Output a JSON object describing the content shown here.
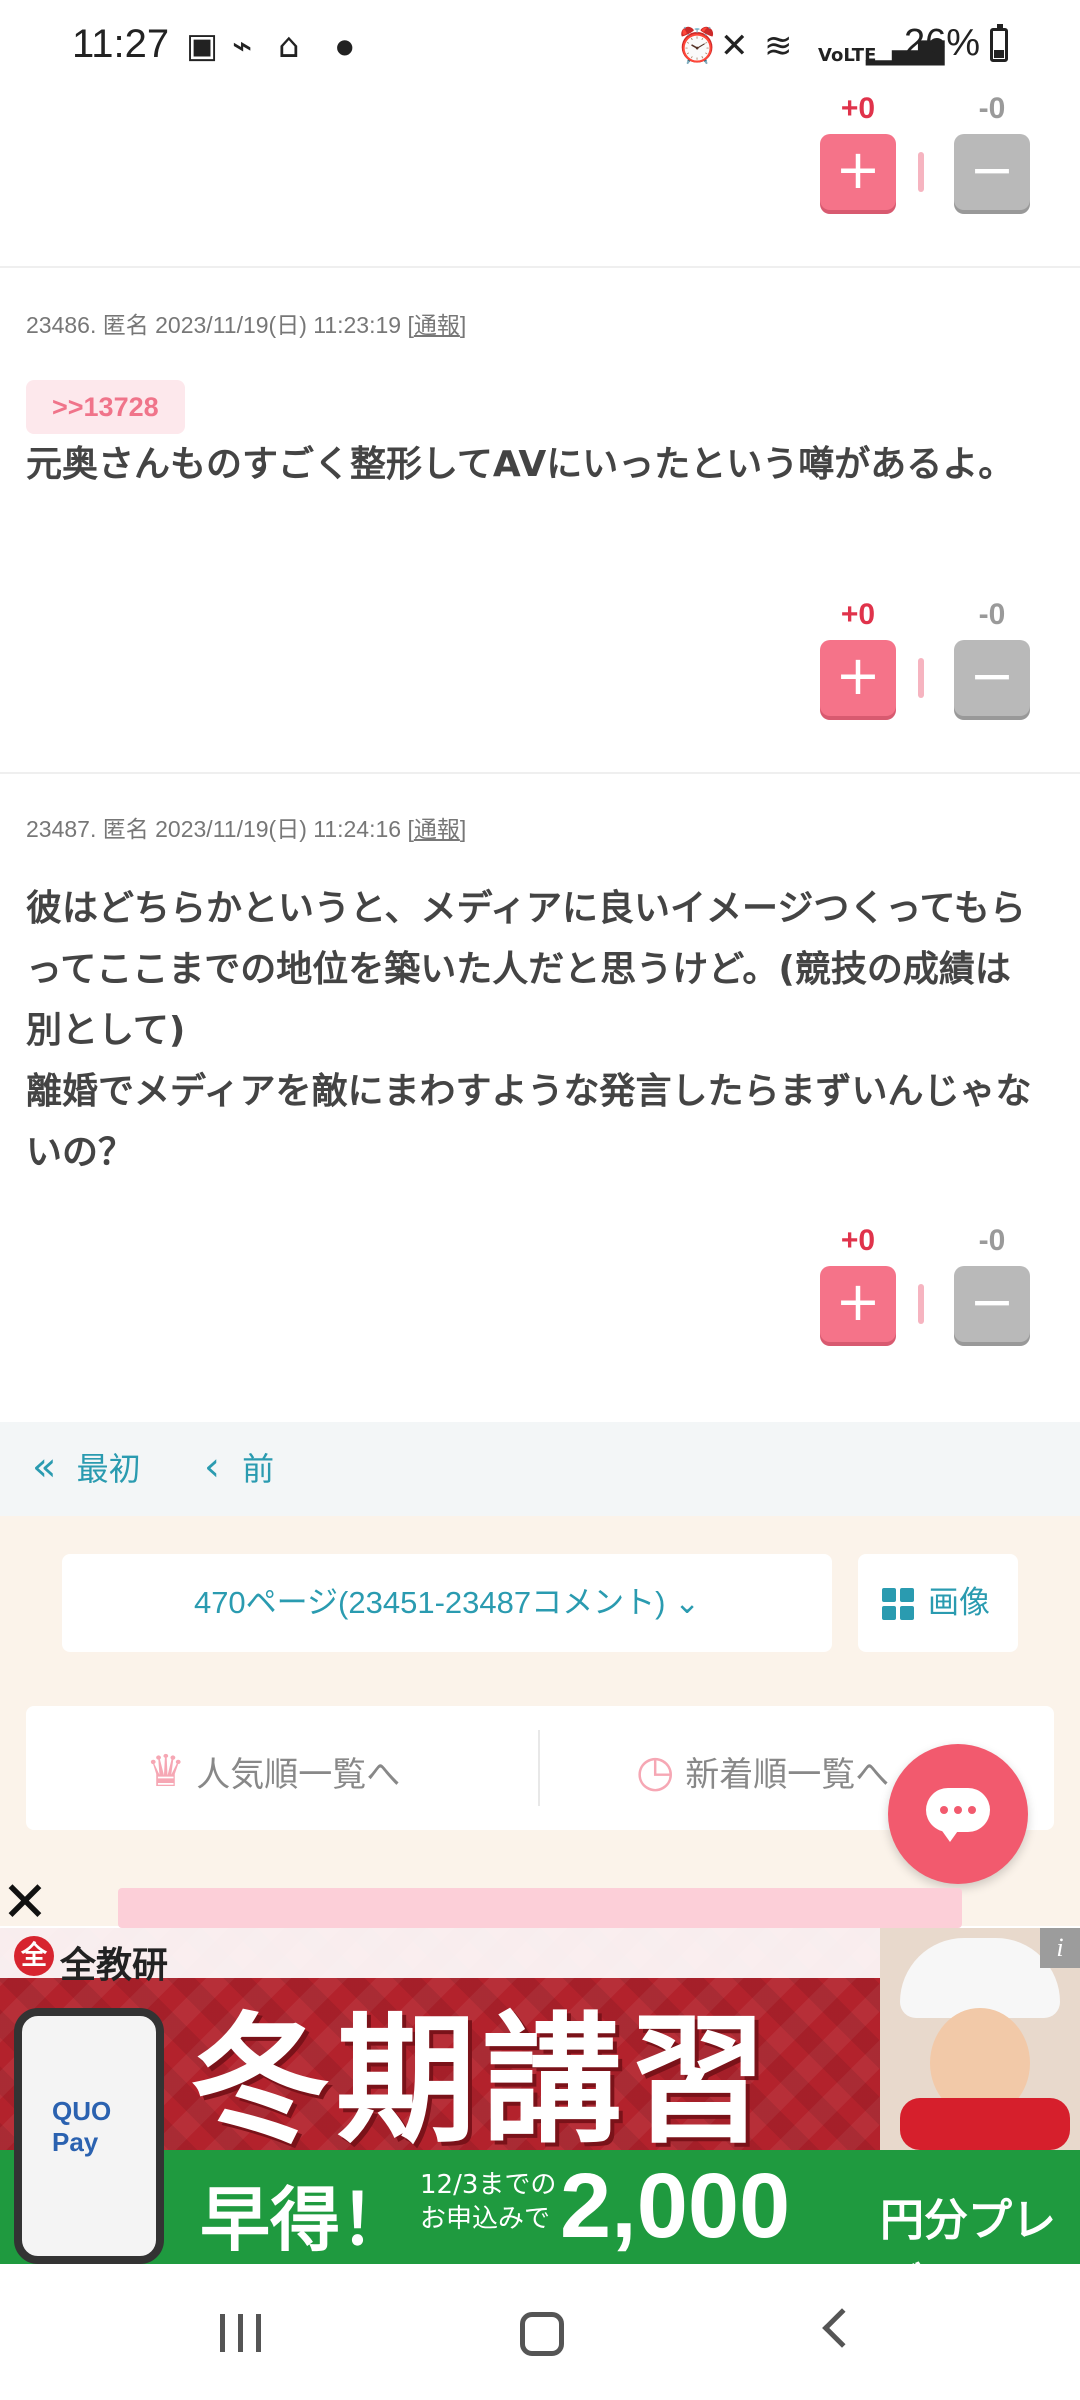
{
  "status_bar": {
    "time": "11:27",
    "battery": "26%",
    "icons": [
      "gallery-icon",
      "app-icon",
      "home-icon",
      "dot-icon",
      "alarm-icon",
      "mute-icon",
      "wifi-icon",
      "volte-icon",
      "signal-icon",
      "battery-icon"
    ]
  },
  "comments": [
    {
      "vote": {
        "plus_count": "+0",
        "minus_count": "-0",
        "plus_label": "+",
        "minus_label": "−"
      }
    },
    {
      "number": "23486.",
      "author": "匿名",
      "datetime": "2023/11/19(日) 11:23:19",
      "report": "通報",
      "anchor": ">>13728",
      "text": "元奥さんものすごく整形してAVにいったという噂があるよ。",
      "vote": {
        "plus_count": "+0",
        "minus_count": "-0",
        "plus_label": "+",
        "minus_label": "−"
      }
    },
    {
      "number": "23487.",
      "author": "匿名",
      "datetime": "2023/11/19(日) 11:24:16",
      "report": "通報",
      "text": "彼はどちらかというと、メディアに良いイメージつくってもらってここまでの地位を築いた人だと思うけど。(競技の成績は別として)\n離婚でメディアを敵にまわすような発言したらまずいんじゃないの？",
      "vote": {
        "plus_count": "+0",
        "minus_count": "-0",
        "plus_label": "+",
        "minus_label": "−"
      }
    }
  ],
  "pager": {
    "first_icon": "«",
    "first_label": "最初",
    "prev_icon": "‹",
    "prev_label": "前"
  },
  "page_select": {
    "label": "470ページ(23451-23487コメント)",
    "chevron": "⌄"
  },
  "image_button": {
    "label": "画像"
  },
  "rank_links": {
    "popular": "人気順一覧へ",
    "newest": "新着順一覧へ"
  },
  "ad": {
    "brand_mark": "全",
    "brand": "全教研",
    "headline": "冬期講習",
    "promo_big": "早得！",
    "promo_small": "12/3までの\nお申込みで",
    "promo_amount": "2,000",
    "promo_tail": "円分プレゼント!",
    "phone_logo": "QUO Pay",
    "info": "i",
    "close": "✕"
  },
  "colors": {
    "accent": "#2a9bb0",
    "plus": "#f57389",
    "minus": "#b9b9b9",
    "plus_count": "#e0334b",
    "fab": "#f25a6e"
  }
}
